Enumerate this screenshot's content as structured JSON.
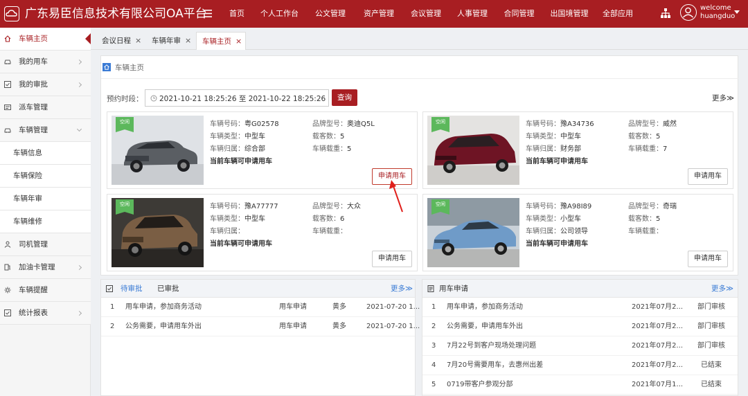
{
  "header": {
    "app_title": "广东易臣信息技术有限公司OA平台",
    "nav": [
      "首页",
      "个人工作台",
      "公文管理",
      "资产管理",
      "会议管理",
      "人事管理",
      "合同管理",
      "出国境管理",
      "全部应用"
    ],
    "user": {
      "greeting": "welcome",
      "name": "huangduo"
    }
  },
  "sidebar": {
    "items": [
      {
        "label": "车辆主页",
        "icon": "home-icon",
        "state": "active"
      },
      {
        "label": "我的用车",
        "icon": "car-icon",
        "chevron": "right"
      },
      {
        "label": "我的审批",
        "icon": "checkbox-icon",
        "chevron": "right"
      },
      {
        "label": "派车管理",
        "icon": "dispatch-icon"
      },
      {
        "label": "车辆管理",
        "icon": "car-icon",
        "chevron": "down"
      },
      {
        "label": "车辆信息",
        "sub": true
      },
      {
        "label": "车辆保险",
        "sub": true
      },
      {
        "label": "车辆年审",
        "sub": true
      },
      {
        "label": "车辆维修",
        "sub": true
      },
      {
        "label": "司机管理",
        "icon": "driver-icon"
      },
      {
        "label": "加油卡管理",
        "icon": "fuel-card-icon",
        "chevron": "right"
      },
      {
        "label": "车辆提醒",
        "icon": "gear-icon"
      },
      {
        "label": "统计报表",
        "icon": "report-icon",
        "chevron": "right"
      }
    ]
  },
  "tabs": [
    {
      "label": "会议日程",
      "close": "×"
    },
    {
      "label": "车辆年审",
      "close": "×"
    },
    {
      "label": "车辆主页",
      "close": "×",
      "active": true
    }
  ],
  "main": {
    "breadcrumb": "车辆主页",
    "filter": {
      "label": "预约时段：",
      "range": "2021-10-21 18:25:26 至 2021-10-22 18:25:26",
      "query_label": "查询"
    },
    "more_label": "更多≫",
    "labels": {
      "plate": "车辆号码：",
      "model": "品牌型号：",
      "type": "车辆类型：",
      "seats": "载客数：",
      "owner": "车辆归属：",
      "load": "车辆载重："
    },
    "cars": [
      {
        "status": "空闲",
        "plate": "粤G02578",
        "model": "奥迪Q5L",
        "type": "中型车",
        "seats": "5",
        "owner": "综合部",
        "load": "5",
        "availability": "当前车辆可申请用车",
        "apply_label": "申请用车",
        "highlighted": true
      },
      {
        "status": "空闲",
        "plate": "豫A34736",
        "model": "威然",
        "type": "中型车",
        "seats": "5",
        "owner": "财务部",
        "load": "7",
        "availability": "当前车辆可申请用车",
        "apply_label": "申请用车"
      },
      {
        "status": "空闲",
        "plate": "豫A77777",
        "model": "大众",
        "type": "中型车",
        "seats": "6",
        "owner": "",
        "load": "",
        "availability": "当前车辆可申请用车",
        "apply_label": "申请用车"
      },
      {
        "status": "空闲",
        "plate": "豫A98I89",
        "model": "奇瑞",
        "type": "小型车",
        "seats": "5",
        "owner": "公司领导",
        "load": "",
        "availability": "当前车辆可申请用车",
        "apply_label": "申请用车"
      }
    ]
  },
  "approval_panel": {
    "tabs": [
      "待审批",
      "已审批"
    ],
    "more_label": "更多≫",
    "rows": [
      {
        "no": "1",
        "title": "用车申请，参加商务活动",
        "type": "用车申请",
        "person": "黄多",
        "date": "2021-07-20 1..."
      },
      {
        "no": "2",
        "title": "公务需要，申请用车外出",
        "type": "用车申请",
        "person": "黄多",
        "date": "2021-07-20 1..."
      }
    ]
  },
  "request_panel": {
    "title": "用车申请",
    "more_label": "更多≫",
    "rows": [
      {
        "no": "1",
        "title": "用车申请，参加商务活动",
        "date": "2021年07月2...",
        "status": "部门审核"
      },
      {
        "no": "2",
        "title": "公务需要，申请用车外出",
        "date": "2021年07月2...",
        "status": "部门审核"
      },
      {
        "no": "3",
        "title": "7月22号到客户现场处理问题",
        "date": "2021年07月2...",
        "status": "部门审核"
      },
      {
        "no": "4",
        "title": "7月20号需要用车，去惠州出差",
        "date": "2021年07月2...",
        "status": "已结束"
      },
      {
        "no": "5",
        "title": "0719带客户参观分部",
        "date": "2021年07月1...",
        "status": "已结束"
      }
    ]
  },
  "colors": {
    "brand": "#a81e22",
    "badge": "#5cb85c",
    "link": "#3a7bd5"
  }
}
